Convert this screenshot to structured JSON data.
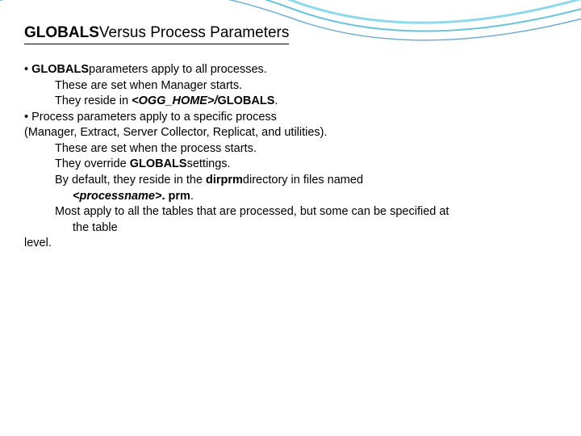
{
  "title": {
    "bold": "GLOBALS",
    "reg": "Versus Process Parameters"
  },
  "lines": {
    "l1a": "• ",
    "l1b": "GLOBALS",
    "l1c": "parameters apply to all processes.",
    "l2": "These are set when Manager starts.",
    "l3a": "They reside in ",
    "l3b": "<OGG_HOME>/",
    "l3c": "GLOBALS",
    "l3d": ".",
    "l4": "• Process parameters apply to a specific process",
    "l5": "(Manager, Extract, Server Collector, Replicat, and utilities).",
    "l6": "These are set when the process starts.",
    "l7a": "They override ",
    "l7b": "GLOBALS",
    "l7c": "settings.",
    "l8a": "By default, they reside in the ",
    "l8b": "dirprm",
    "l8c": "directory in files named",
    "l9a": "<processname>",
    "l9b": ". prm",
    "l9c": ".",
    "l10": "Most apply to all the tables that are processed, but some can be specified at",
    "l11": "the table",
    "l12": "level."
  }
}
